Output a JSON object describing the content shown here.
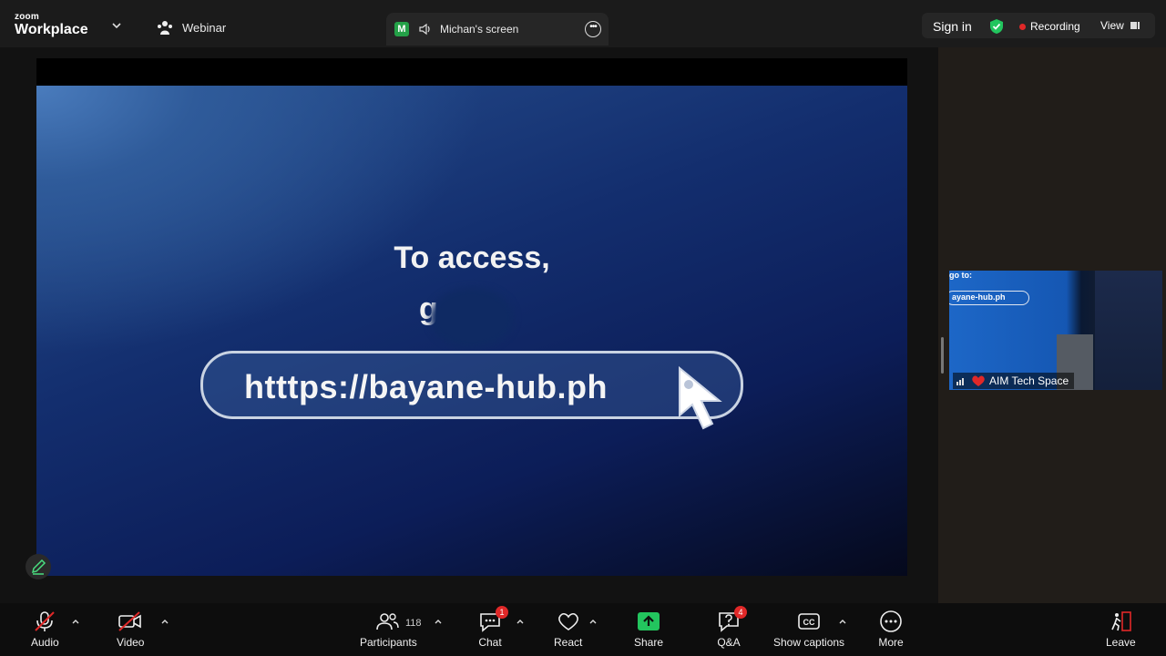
{
  "app": {
    "brand_top": "zoom",
    "brand_bottom": "Workplace",
    "meeting_type": "Webinar"
  },
  "screen_share": {
    "avatar_letter": "M",
    "owner_label": "Michan's screen"
  },
  "top_right": {
    "sign_in": "Sign in",
    "recording": "Recording",
    "view": "View"
  },
  "slide": {
    "heading": "To access,",
    "subheading_partial": "g       :",
    "url": "htttps://bayane-hub.ph"
  },
  "thumbnail": {
    "go_to": "go to:",
    "url": "ayane-hub.ph",
    "participant_name": "AIM Tech Space"
  },
  "toolbar": {
    "audio": "Audio",
    "video": "Video",
    "participants": "Participants",
    "participants_count": "118",
    "chat": "Chat",
    "chat_badge": "1",
    "react": "React",
    "share": "Share",
    "qa": "Q&A",
    "qa_badge": "4",
    "captions": "Show captions",
    "more": "More",
    "leave": "Leave"
  },
  "colors": {
    "share_green": "#23c55e",
    "recording_red": "#e02828",
    "shield_green": "#22c55e",
    "badge_red": "#e02828"
  }
}
